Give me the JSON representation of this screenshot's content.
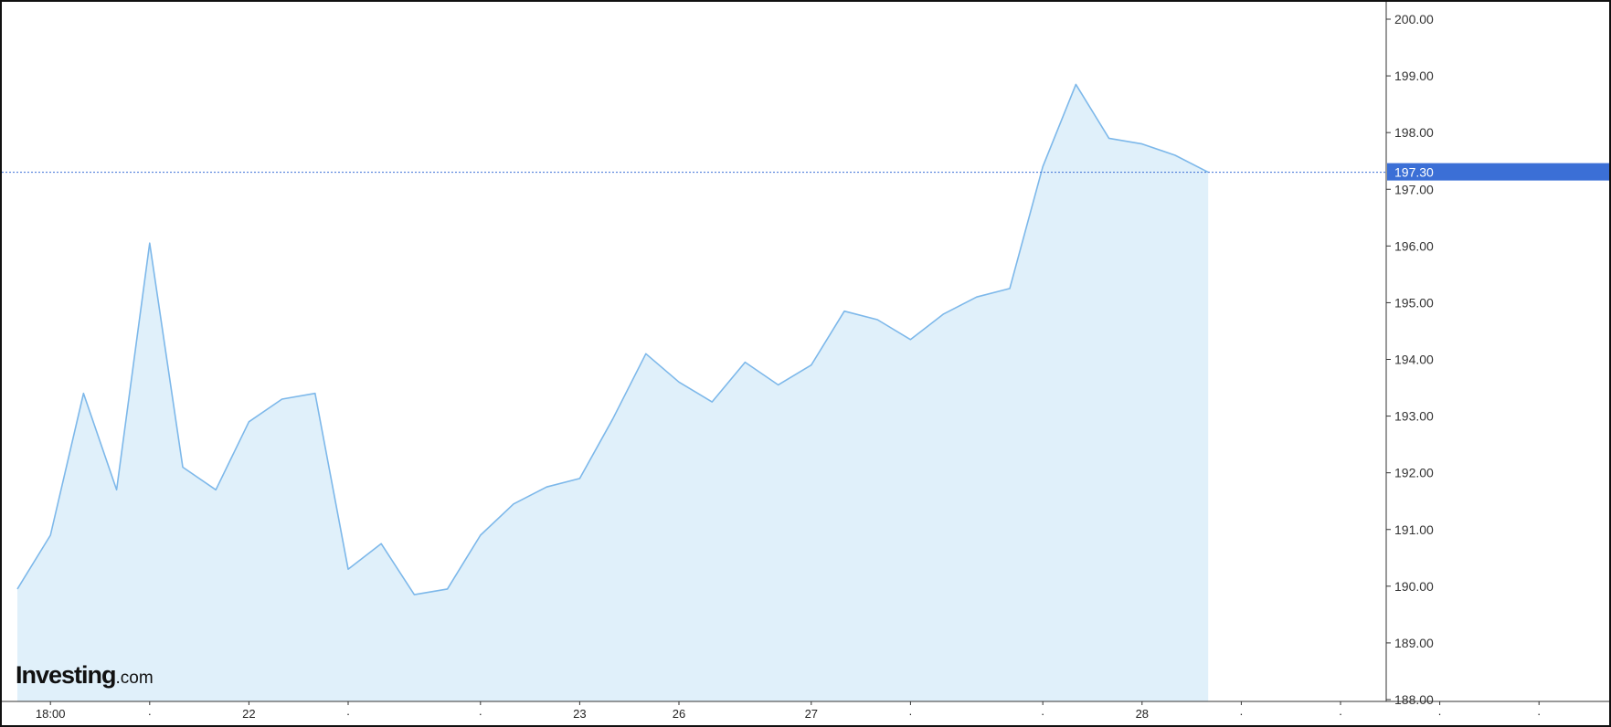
{
  "logo": {
    "brand": "Investing",
    "suffix": ".com"
  },
  "colors": {
    "line": "#7db8ea",
    "fill": "#e0f0fa",
    "current_price_bg": "#3b6fd6",
    "current_price_line": "#3b6fd6",
    "axis": "#333333"
  },
  "chart_data": {
    "type": "area",
    "title": "",
    "xlabel": "",
    "ylabel": "",
    "ylim": [
      188,
      200
    ],
    "y_ticks": [
      "200.00",
      "199.00",
      "198.00",
      "197.00",
      "196.00",
      "195.00",
      "194.00",
      "193.00",
      "192.00",
      "191.00",
      "190.00",
      "189.00",
      "188.00"
    ],
    "x_tick_labels": [
      {
        "index": 1,
        "label": "18:00"
      },
      {
        "index": 4,
        "label": "·"
      },
      {
        "index": 7,
        "label": "22"
      },
      {
        "index": 10,
        "label": "·"
      },
      {
        "index": 14,
        "label": "·"
      },
      {
        "index": 17,
        "label": "23"
      },
      {
        "index": 20,
        "label": "26"
      },
      {
        "index": 24,
        "label": "27"
      },
      {
        "index": 27,
        "label": "·"
      },
      {
        "index": 31,
        "label": "·"
      },
      {
        "index": 34,
        "label": "28"
      },
      {
        "index": 37,
        "label": "·"
      },
      {
        "index": 40,
        "label": "·"
      },
      {
        "index": 43,
        "label": "·"
      },
      {
        "index": 46,
        "label": "·"
      }
    ],
    "x_slots": 47,
    "current_price": {
      "value": 197.3,
      "label": "197.30"
    },
    "series": [
      {
        "values": [
          189.95,
          190.9,
          193.4,
          191.7,
          196.05,
          192.1,
          191.7,
          192.9,
          193.3,
          193.4,
          190.3,
          190.75,
          189.85,
          189.95,
          190.9,
          191.45,
          191.75,
          191.9,
          192.95,
          194.1,
          193.6,
          193.25,
          193.95,
          193.55,
          193.9,
          194.85,
          194.7,
          194.35,
          194.8,
          195.1,
          195.25,
          197.4,
          198.85,
          197.9,
          197.8,
          197.6,
          197.3
        ]
      }
    ]
  }
}
